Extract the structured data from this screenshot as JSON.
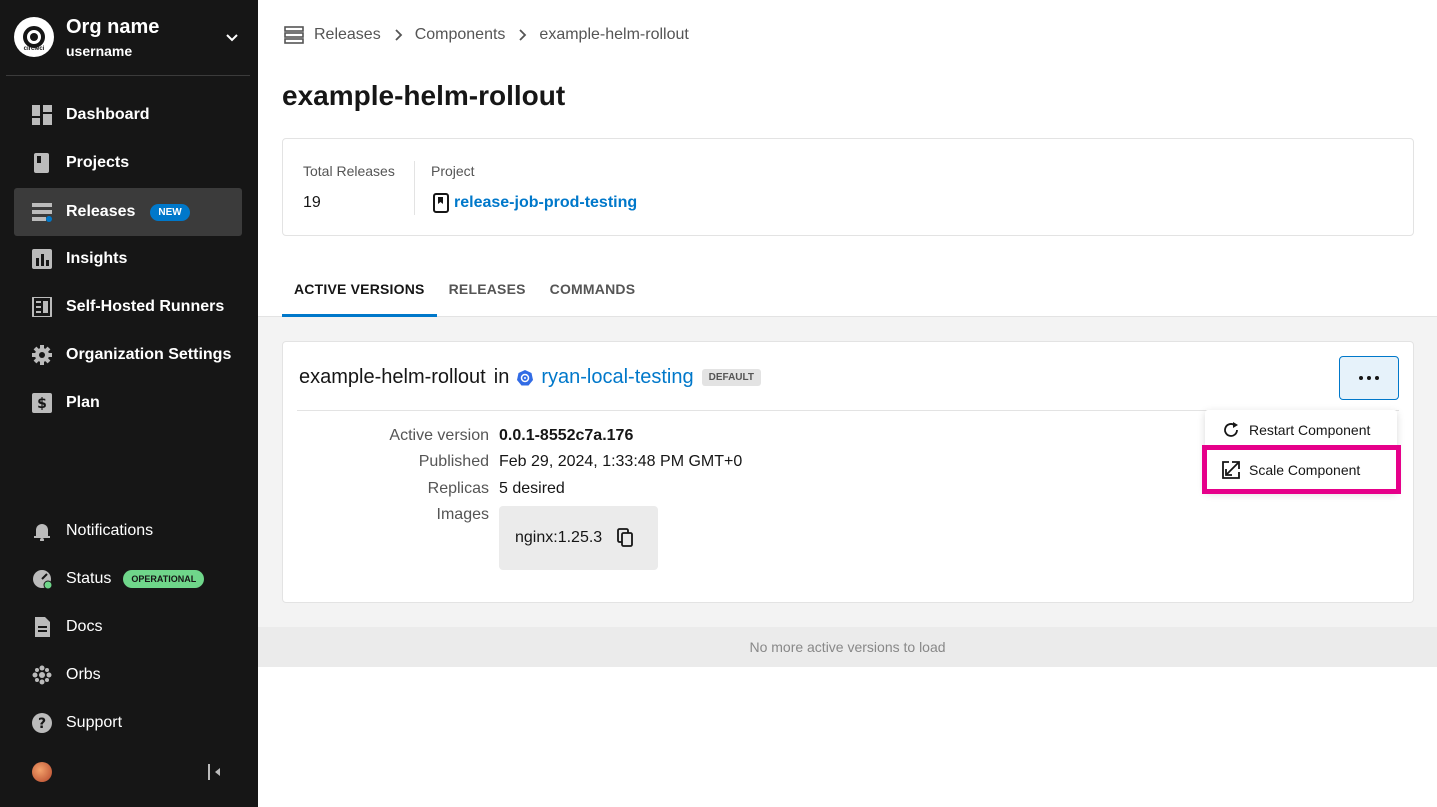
{
  "org": {
    "name": "Org name",
    "username": "username",
    "logo_text": "circleci"
  },
  "nav": {
    "items": [
      {
        "label": "Dashboard",
        "icon": "dashboard-icon"
      },
      {
        "label": "Projects",
        "icon": "projects-icon"
      },
      {
        "label": "Releases",
        "icon": "releases-icon",
        "badge": "NEW",
        "active": true
      },
      {
        "label": "Insights",
        "icon": "insights-icon"
      },
      {
        "label": "Self-Hosted Runners",
        "icon": "runners-icon"
      },
      {
        "label": "Organization Settings",
        "icon": "gear-icon"
      },
      {
        "label": "Plan",
        "icon": "dollar-icon"
      }
    ],
    "bottom": [
      {
        "label": "Notifications",
        "icon": "bell-icon"
      },
      {
        "label": "Status",
        "icon": "status-icon",
        "badge": "OPERATIONAL"
      },
      {
        "label": "Docs",
        "icon": "docs-icon"
      },
      {
        "label": "Orbs",
        "icon": "orbs-icon"
      },
      {
        "label": "Support",
        "icon": "help-icon"
      }
    ]
  },
  "breadcrumb": {
    "items": [
      "Releases",
      "Components",
      "example-helm-rollout"
    ]
  },
  "page": {
    "title": "example-helm-rollout"
  },
  "summary": {
    "total_label": "Total Releases",
    "total_value": "19",
    "project_label": "Project",
    "project_value": "release-job-prod-testing"
  },
  "tabs": [
    "ACTIVE VERSIONS",
    "RELEASES",
    "COMMANDS"
  ],
  "component": {
    "name": "example-helm-rollout",
    "in": "in",
    "environment": "ryan-local-testing",
    "env_badge": "DEFAULT",
    "rows": {
      "active_version_label": "Active version",
      "active_version_value": "0.0.1-8552c7a.176",
      "published_label": "Published",
      "published_value": "Feb 29, 2024, 1:33:48 PM GMT+0",
      "replicas_label": "Replicas",
      "replicas_value": "5 desired",
      "images_label": "Images",
      "image_value": "nginx:1.25.3"
    }
  },
  "menu": {
    "restart": "Restart Component",
    "scale": "Scale Component"
  },
  "footer": {
    "no_more": "No more active versions to load"
  },
  "colors": {
    "accent": "#0078ca",
    "highlight": "#e6008a",
    "sidebar": "#161616",
    "operational": "#6fd68a"
  }
}
